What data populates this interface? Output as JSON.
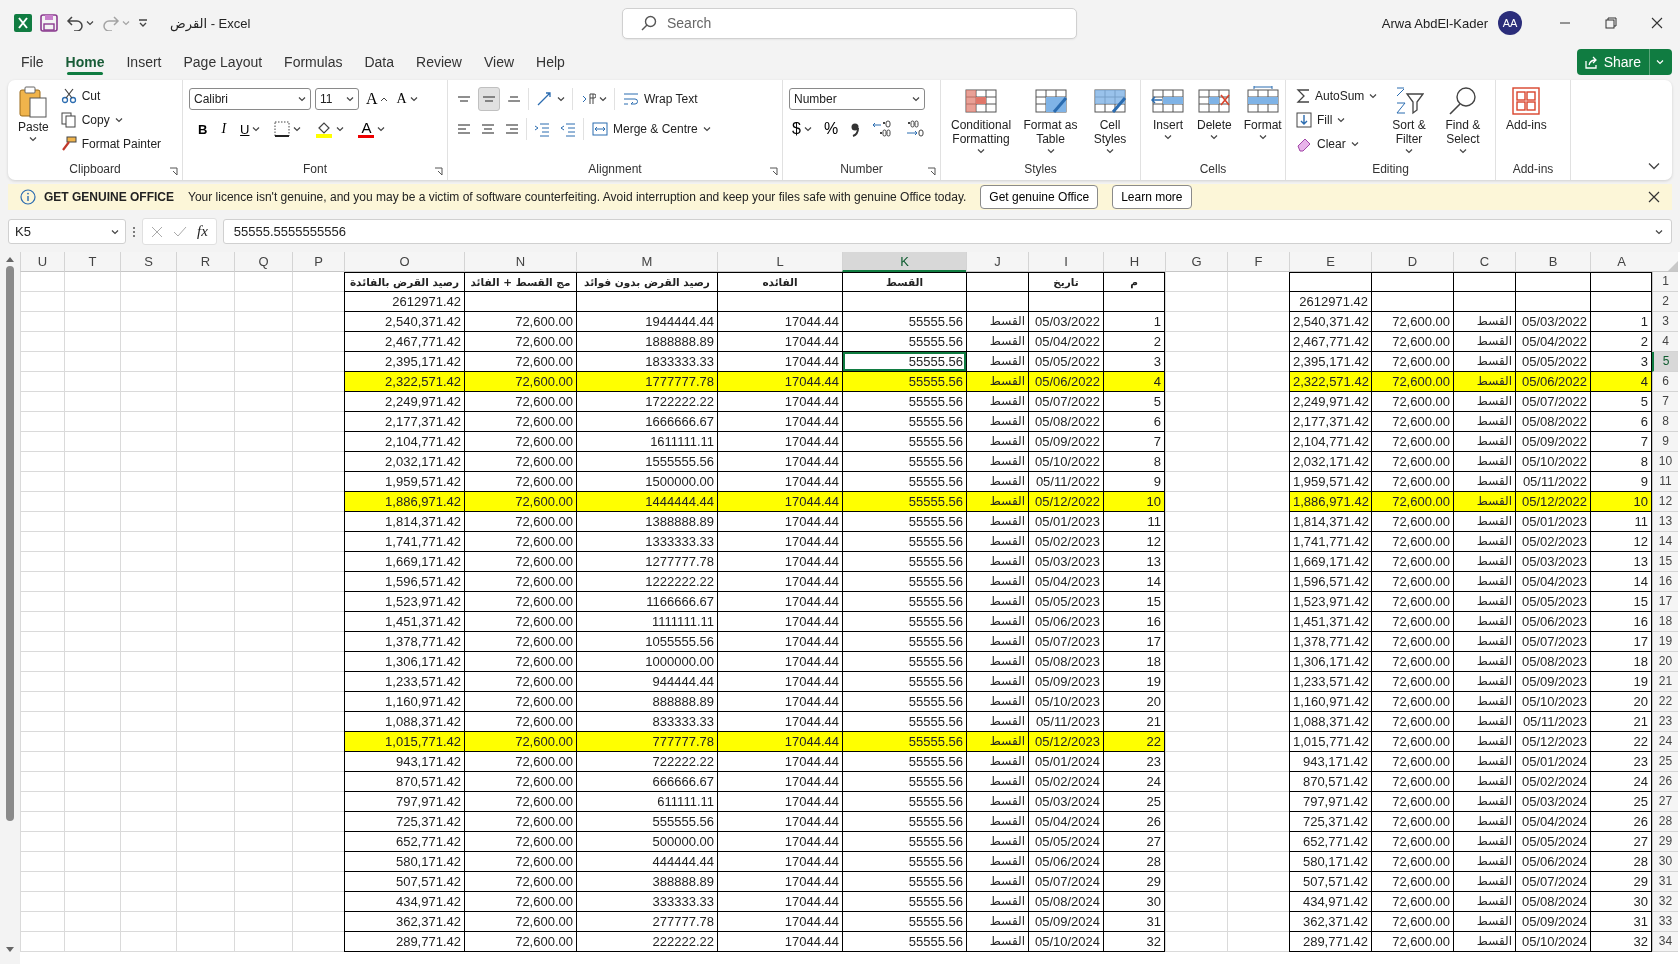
{
  "window": {
    "title": "القرض  -  Excel",
    "search_placeholder": "Search",
    "user_name": "Arwa AbdEl-Kader",
    "user_initials": "AA"
  },
  "tabs": [
    {
      "label": "File",
      "selected": false
    },
    {
      "label": "Home",
      "selected": true
    },
    {
      "label": "Insert",
      "selected": false
    },
    {
      "label": "Page Layout",
      "selected": false
    },
    {
      "label": "Formulas",
      "selected": false
    },
    {
      "label": "Data",
      "selected": false
    },
    {
      "label": "Review",
      "selected": false
    },
    {
      "label": "View",
      "selected": false
    },
    {
      "label": "Help",
      "selected": false
    }
  ],
  "share_label": "Share",
  "ribbon": {
    "clipboard": {
      "label": "Clipboard",
      "paste": "Paste",
      "cut": "Cut",
      "copy": "Copy",
      "format_painter": "Format Painter"
    },
    "font": {
      "label": "Font",
      "font_name": "Calibri",
      "font_size": "11",
      "grow": "A",
      "shrink": "A",
      "bold": "B",
      "italic": "I",
      "underline": "U",
      "font_color": "A"
    },
    "alignment": {
      "label": "Alignment",
      "wrap_text": "Wrap Text",
      "merge": "Merge & Centre"
    },
    "number": {
      "label": "Number",
      "format": "Number",
      "currency": "$",
      "percent": "%"
    },
    "styles": {
      "label": "Styles",
      "conditional": "Conditional Formatting",
      "format_table": "Format as Table",
      "cell_styles": "Cell Styles"
    },
    "cells": {
      "label": "Cells",
      "insert": "Insert",
      "delete": "Delete",
      "format": "Format"
    },
    "editing": {
      "label": "Editing",
      "autosum": "AutoSum",
      "fill": "Fill",
      "clear": "Clear",
      "sort": "Sort & Filter",
      "find": "Find & Select"
    },
    "addins": {
      "label": "Add-ins",
      "addins": "Add-ins"
    }
  },
  "notice": {
    "title": "GET GENUINE OFFICE",
    "message": "Your licence isn't genuine, and you may be a victim of software counterfeiting. Avoid interruption and keep your files safe with genuine Office today.",
    "buttons": [
      "Get genuine Office",
      "Learn more"
    ]
  },
  "formula_bar": {
    "name_box": "K5",
    "function_label": "fx",
    "value": "55555.5555555556"
  },
  "column_headers": [
    {
      "label": "U",
      "selected": false
    },
    {
      "label": "T",
      "selected": false
    },
    {
      "label": "S",
      "selected": false
    },
    {
      "label": "R",
      "selected": false
    },
    {
      "label": "Q",
      "selected": false
    },
    {
      "label": "P",
      "selected": false
    },
    {
      "label": "O",
      "selected": false
    },
    {
      "label": "N",
      "selected": false
    },
    {
      "label": "M",
      "selected": false
    },
    {
      "label": "L",
      "selected": false
    },
    {
      "label": "K",
      "selected": true
    },
    {
      "label": "J",
      "selected": false
    },
    {
      "label": "I",
      "selected": false
    },
    {
      "label": "H",
      "selected": false
    },
    {
      "label": "G",
      "selected": false
    },
    {
      "label": "F",
      "selected": false
    },
    {
      "label": "E",
      "selected": false
    },
    {
      "label": "D",
      "selected": false
    },
    {
      "label": "C",
      "selected": false
    },
    {
      "label": "B",
      "selected": false
    },
    {
      "label": "A",
      "selected": false
    }
  ],
  "row_headers": [
    {
      "label": "1",
      "selected": false
    },
    {
      "label": "2",
      "selected": false
    },
    {
      "label": "3",
      "selected": false
    },
    {
      "label": "4",
      "selected": false
    },
    {
      "label": "5",
      "selected": true
    },
    {
      "label": "6",
      "selected": false
    },
    {
      "label": "7",
      "selected": false
    },
    {
      "label": "8",
      "selected": false
    },
    {
      "label": "9",
      "selected": false
    },
    {
      "label": "10",
      "selected": false
    },
    {
      "label": "11",
      "selected": false
    },
    {
      "label": "12",
      "selected": false
    },
    {
      "label": "13",
      "selected": false
    },
    {
      "label": "14",
      "selected": false
    },
    {
      "label": "15",
      "selected": false
    },
    {
      "label": "16",
      "selected": false
    },
    {
      "label": "17",
      "selected": false
    },
    {
      "label": "18",
      "selected": false
    },
    {
      "label": "19",
      "selected": false
    },
    {
      "label": "20",
      "selected": false
    },
    {
      "label": "21",
      "selected": false
    },
    {
      "label": "22",
      "selected": false
    },
    {
      "label": "23",
      "selected": false
    },
    {
      "label": "24",
      "selected": false
    },
    {
      "label": "25",
      "selected": false
    },
    {
      "label": "26",
      "selected": false
    },
    {
      "label": "27",
      "selected": false
    },
    {
      "label": "28",
      "selected": false
    },
    {
      "label": "29",
      "selected": false
    },
    {
      "label": "30",
      "selected": false
    },
    {
      "label": "31",
      "selected": false
    },
    {
      "label": "32",
      "selected": false
    },
    {
      "label": "33",
      "selected": false
    },
    {
      "label": "34",
      "selected": false
    }
  ],
  "left_table": {
    "headers": {
      "n": "م",
      "date": "تاريخ",
      "installment": "القسط",
      "interest": "الفائده",
      "principal_balance": "رصيد القرض بدون فوائد",
      "total": "مج القسط + الفائد",
      "balance": "رصيد القرض بالفائدة"
    },
    "opening_balance": "2612971.42",
    "rows": [
      {
        "n": "1",
        "date": "05/03/2022",
        "type": "القسط",
        "installment": "55555.56",
        "interest": "17044.44",
        "principal_balance": "1944444.44",
        "total": "72,600.00",
        "balance": "2,540,371.42",
        "highlighted": false,
        "selected": false
      },
      {
        "n": "2",
        "date": "05/04/2022",
        "type": "القسط",
        "installment": "55555.56",
        "interest": "17044.44",
        "principal_balance": "1888888.89",
        "total": "72,600.00",
        "balance": "2,467,771.42",
        "highlighted": false,
        "selected": false
      },
      {
        "n": "3",
        "date": "05/05/2022",
        "type": "القسط",
        "installment": "55555.56",
        "interest": "17044.44",
        "principal_balance": "1833333.33",
        "total": "72,600.00",
        "balance": "2,395,171.42",
        "highlighted": false,
        "selected": true
      },
      {
        "n": "4",
        "date": "05/06/2022",
        "type": "القسط",
        "installment": "55555.56",
        "interest": "17044.44",
        "principal_balance": "1777777.78",
        "total": "72,600.00",
        "balance": "2,322,571.42",
        "highlighted": true,
        "selected": false
      },
      {
        "n": "5",
        "date": "05/07/2022",
        "type": "القسط",
        "installment": "55555.56",
        "interest": "17044.44",
        "principal_balance": "1722222.22",
        "total": "72,600.00",
        "balance": "2,249,971.42",
        "highlighted": false,
        "selected": false
      },
      {
        "n": "6",
        "date": "05/08/2022",
        "type": "القسط",
        "installment": "55555.56",
        "interest": "17044.44",
        "principal_balance": "1666666.67",
        "total": "72,600.00",
        "balance": "2,177,371.42",
        "highlighted": false,
        "selected": false
      },
      {
        "n": "7",
        "date": "05/09/2022",
        "type": "القسط",
        "installment": "55555.56",
        "interest": "17044.44",
        "principal_balance": "1611111.11",
        "total": "72,600.00",
        "balance": "2,104,771.42",
        "highlighted": false,
        "selected": false
      },
      {
        "n": "8",
        "date": "05/10/2022",
        "type": "القسط",
        "installment": "55555.56",
        "interest": "17044.44",
        "principal_balance": "1555555.56",
        "total": "72,600.00",
        "balance": "2,032,171.42",
        "highlighted": false,
        "selected": false
      },
      {
        "n": "9",
        "date": "05/11/2022",
        "type": "القسط",
        "installment": "55555.56",
        "interest": "17044.44",
        "principal_balance": "1500000.00",
        "total": "72,600.00",
        "balance": "1,959,571.42",
        "highlighted": false,
        "selected": false
      },
      {
        "n": "10",
        "date": "05/12/2022",
        "type": "القسط",
        "installment": "55555.56",
        "interest": "17044.44",
        "principal_balance": "1444444.44",
        "total": "72,600.00",
        "balance": "1,886,971.42",
        "highlighted": true,
        "selected": false
      },
      {
        "n": "11",
        "date": "05/01/2023",
        "type": "القسط",
        "installment": "55555.56",
        "interest": "17044.44",
        "principal_balance": "1388888.89",
        "total": "72,600.00",
        "balance": "1,814,371.42",
        "highlighted": false,
        "selected": false
      },
      {
        "n": "12",
        "date": "05/02/2023",
        "type": "القسط",
        "installment": "55555.56",
        "interest": "17044.44",
        "principal_balance": "1333333.33",
        "total": "72,600.00",
        "balance": "1,741,771.42",
        "highlighted": false,
        "selected": false
      },
      {
        "n": "13",
        "date": "05/03/2023",
        "type": "القسط",
        "installment": "55555.56",
        "interest": "17044.44",
        "principal_balance": "1277777.78",
        "total": "72,600.00",
        "balance": "1,669,171.42",
        "highlighted": false,
        "selected": false
      },
      {
        "n": "14",
        "date": "05/04/2023",
        "type": "القسط",
        "installment": "55555.56",
        "interest": "17044.44",
        "principal_balance": "1222222.22",
        "total": "72,600.00",
        "balance": "1,596,571.42",
        "highlighted": false,
        "selected": false
      },
      {
        "n": "15",
        "date": "05/05/2023",
        "type": "القسط",
        "installment": "55555.56",
        "interest": "17044.44",
        "principal_balance": "1166666.67",
        "total": "72,600.00",
        "balance": "1,523,971.42",
        "highlighted": false,
        "selected": false
      },
      {
        "n": "16",
        "date": "05/06/2023",
        "type": "القسط",
        "installment": "55555.56",
        "interest": "17044.44",
        "principal_balance": "1111111.11",
        "total": "72,600.00",
        "balance": "1,451,371.42",
        "highlighted": false,
        "selected": false
      },
      {
        "n": "17",
        "date": "05/07/2023",
        "type": "القسط",
        "installment": "55555.56",
        "interest": "17044.44",
        "principal_balance": "1055555.56",
        "total": "72,600.00",
        "balance": "1,378,771.42",
        "highlighted": false,
        "selected": false
      },
      {
        "n": "18",
        "date": "05/08/2023",
        "type": "القسط",
        "installment": "55555.56",
        "interest": "17044.44",
        "principal_balance": "1000000.00",
        "total": "72,600.00",
        "balance": "1,306,171.42",
        "highlighted": false,
        "selected": false
      },
      {
        "n": "19",
        "date": "05/09/2023",
        "type": "القسط",
        "installment": "55555.56",
        "interest": "17044.44",
        "principal_balance": "944444.44",
        "total": "72,600.00",
        "balance": "1,233,571.42",
        "highlighted": false,
        "selected": false
      },
      {
        "n": "20",
        "date": "05/10/2023",
        "type": "القسط",
        "installment": "55555.56",
        "interest": "17044.44",
        "principal_balance": "888888.89",
        "total": "72,600.00",
        "balance": "1,160,971.42",
        "highlighted": false,
        "selected": false
      },
      {
        "n": "21",
        "date": "05/11/2023",
        "type": "القسط",
        "installment": "55555.56",
        "interest": "17044.44",
        "principal_balance": "833333.33",
        "total": "72,600.00",
        "balance": "1,088,371.42",
        "highlighted": false,
        "selected": false
      },
      {
        "n": "22",
        "date": "05/12/2023",
        "type": "القسط",
        "installment": "55555.56",
        "interest": "17044.44",
        "principal_balance": "777777.78",
        "total": "72,600.00",
        "balance": "1,015,771.42",
        "highlighted": true,
        "selected": false
      },
      {
        "n": "23",
        "date": "05/01/2024",
        "type": "القسط",
        "installment": "55555.56",
        "interest": "17044.44",
        "principal_balance": "722222.22",
        "total": "72,600.00",
        "balance": "943,171.42",
        "highlighted": false,
        "selected": false
      },
      {
        "n": "24",
        "date": "05/02/2024",
        "type": "القسط",
        "installment": "55555.56",
        "interest": "17044.44",
        "principal_balance": "666666.67",
        "total": "72,600.00",
        "balance": "870,571.42",
        "highlighted": false,
        "selected": false
      },
      {
        "n": "25",
        "date": "05/03/2024",
        "type": "القسط",
        "installment": "55555.56",
        "interest": "17044.44",
        "principal_balance": "611111.11",
        "total": "72,600.00",
        "balance": "797,971.42",
        "highlighted": false,
        "selected": false
      },
      {
        "n": "26",
        "date": "05/04/2024",
        "type": "القسط",
        "installment": "55555.56",
        "interest": "17044.44",
        "principal_balance": "555555.56",
        "total": "72,600.00",
        "balance": "725,371.42",
        "highlighted": false,
        "selected": false
      },
      {
        "n": "27",
        "date": "05/05/2024",
        "type": "القسط",
        "installment": "55555.56",
        "interest": "17044.44",
        "principal_balance": "500000.00",
        "total": "72,600.00",
        "balance": "652,771.42",
        "highlighted": false,
        "selected": false
      },
      {
        "n": "28",
        "date": "05/06/2024",
        "type": "القسط",
        "installment": "55555.56",
        "interest": "17044.44",
        "principal_balance": "444444.44",
        "total": "72,600.00",
        "balance": "580,171.42",
        "highlighted": false,
        "selected": false
      },
      {
        "n": "29",
        "date": "05/07/2024",
        "type": "القسط",
        "installment": "55555.56",
        "interest": "17044.44",
        "principal_balance": "388888.89",
        "total": "72,600.00",
        "balance": "507,571.42",
        "highlighted": false,
        "selected": false
      },
      {
        "n": "30",
        "date": "05/08/2024",
        "type": "القسط",
        "installment": "55555.56",
        "interest": "17044.44",
        "principal_balance": "333333.33",
        "total": "72,600.00",
        "balance": "434,971.42",
        "highlighted": false,
        "selected": false
      },
      {
        "n": "31",
        "date": "05/09/2024",
        "type": "القسط",
        "installment": "55555.56",
        "interest": "17044.44",
        "principal_balance": "277777.78",
        "total": "72,600.00",
        "balance": "362,371.42",
        "highlighted": false,
        "selected": false
      },
      {
        "n": "32",
        "date": "05/10/2024",
        "type": "القسط",
        "installment": "55555.56",
        "interest": "17044.44",
        "principal_balance": "222222.22",
        "total": "72,600.00",
        "balance": "289,771.42",
        "highlighted": false,
        "selected": false
      }
    ]
  },
  "right_table": {
    "opening_balance": "2612971.42",
    "rows": [
      {
        "n": "1",
        "date": "05/03/2022",
        "type": "القسط",
        "total": "72,600.00",
        "balance": "2,540,371.42",
        "highlighted": false
      },
      {
        "n": "2",
        "date": "05/04/2022",
        "type": "القسط",
        "total": "72,600.00",
        "balance": "2,467,771.42",
        "highlighted": false
      },
      {
        "n": "3",
        "date": "05/05/2022",
        "type": "القسط",
        "total": "72,600.00",
        "balance": "2,395,171.42",
        "highlighted": false
      },
      {
        "n": "4",
        "date": "05/06/2022",
        "type": "القسط",
        "total": "72,600.00",
        "balance": "2,322,571.42",
        "highlighted": true
      },
      {
        "n": "5",
        "date": "05/07/2022",
        "type": "القسط",
        "total": "72,600.00",
        "balance": "2,249,971.42",
        "highlighted": false
      },
      {
        "n": "6",
        "date": "05/08/2022",
        "type": "القسط",
        "total": "72,600.00",
        "balance": "2,177,371.42",
        "highlighted": false
      },
      {
        "n": "7",
        "date": "05/09/2022",
        "type": "القسط",
        "total": "72,600.00",
        "balance": "2,104,771.42",
        "highlighted": false
      },
      {
        "n": "8",
        "date": "05/10/2022",
        "type": "القسط",
        "total": "72,600.00",
        "balance": "2,032,171.42",
        "highlighted": false
      },
      {
        "n": "9",
        "date": "05/11/2022",
        "type": "القسط",
        "total": "72,600.00",
        "balance": "1,959,571.42",
        "highlighted": false
      },
      {
        "n": "10",
        "date": "05/12/2022",
        "type": "القسط",
        "total": "72,600.00",
        "balance": "1,886,971.42",
        "highlighted": true
      },
      {
        "n": "11",
        "date": "05/01/2023",
        "type": "القسط",
        "total": "72,600.00",
        "balance": "1,814,371.42",
        "highlighted": false
      },
      {
        "n": "12",
        "date": "05/02/2023",
        "type": "القسط",
        "total": "72,600.00",
        "balance": "1,741,771.42",
        "highlighted": false
      },
      {
        "n": "13",
        "date": "05/03/2023",
        "type": "القسط",
        "total": "72,600.00",
        "balance": "1,669,171.42",
        "highlighted": false
      },
      {
        "n": "14",
        "date": "05/04/2023",
        "type": "القسط",
        "total": "72,600.00",
        "balance": "1,596,571.42",
        "highlighted": false
      },
      {
        "n": "15",
        "date": "05/05/2023",
        "type": "القسط",
        "total": "72,600.00",
        "balance": "1,523,971.42",
        "highlighted": false
      },
      {
        "n": "16",
        "date": "05/06/2023",
        "type": "القسط",
        "total": "72,600.00",
        "balance": "1,451,371.42",
        "highlighted": false
      },
      {
        "n": "17",
        "date": "05/07/2023",
        "type": "القسط",
        "total": "72,600.00",
        "balance": "1,378,771.42",
        "highlighted": false
      },
      {
        "n": "18",
        "date": "05/08/2023",
        "type": "القسط",
        "total": "72,600.00",
        "balance": "1,306,171.42",
        "highlighted": false
      },
      {
        "n": "19",
        "date": "05/09/2023",
        "type": "القسط",
        "total": "72,600.00",
        "balance": "1,233,571.42",
        "highlighted": false
      },
      {
        "n": "20",
        "date": "05/10/2023",
        "type": "القسط",
        "total": "72,600.00",
        "balance": "1,160,971.42",
        "highlighted": false
      },
      {
        "n": "21",
        "date": "05/11/2023",
        "type": "القسط",
        "total": "72,600.00",
        "balance": "1,088,371.42",
        "highlighted": false
      },
      {
        "n": "22",
        "date": "05/12/2023",
        "type": "القسط",
        "total": "72,600.00",
        "balance": "1,015,771.42",
        "highlighted": false
      },
      {
        "n": "23",
        "date": "05/01/2024",
        "type": "القسط",
        "total": "72,600.00",
        "balance": "943,171.42",
        "highlighted": false
      },
      {
        "n": "24",
        "date": "05/02/2024",
        "type": "القسط",
        "total": "72,600.00",
        "balance": "870,571.42",
        "highlighted": false
      },
      {
        "n": "25",
        "date": "05/03/2024",
        "type": "القسط",
        "total": "72,600.00",
        "balance": "797,971.42",
        "highlighted": false
      },
      {
        "n": "26",
        "date": "05/04/2024",
        "type": "القسط",
        "total": "72,600.00",
        "balance": "725,371.42",
        "highlighted": false
      },
      {
        "n": "27",
        "date": "05/05/2024",
        "type": "القسط",
        "total": "72,600.00",
        "balance": "652,771.42",
        "highlighted": false
      },
      {
        "n": "28",
        "date": "05/06/2024",
        "type": "القسط",
        "total": "72,600.00",
        "balance": "580,171.42",
        "highlighted": false
      },
      {
        "n": "29",
        "date": "05/07/2024",
        "type": "القسط",
        "total": "72,600.00",
        "balance": "507,571.42",
        "highlighted": false
      },
      {
        "n": "30",
        "date": "05/08/2024",
        "type": "القسط",
        "total": "72,600.00",
        "balance": "434,971.42",
        "highlighted": false
      },
      {
        "n": "31",
        "date": "05/09/2024",
        "type": "القسط",
        "total": "72,600.00",
        "balance": "362,371.42",
        "highlighted": false
      },
      {
        "n": "32",
        "date": "05/10/2024",
        "type": "القسط",
        "total": "72,600.00",
        "balance": "289,771.42",
        "highlighted": false
      }
    ]
  }
}
